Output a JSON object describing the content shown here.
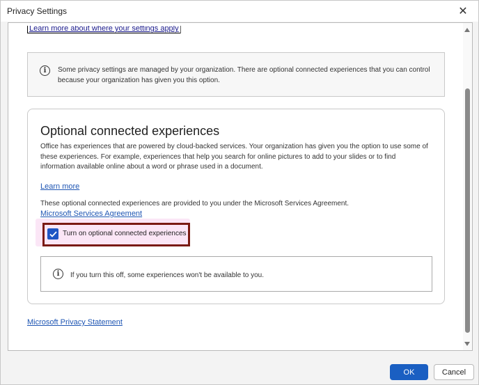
{
  "window": {
    "title": "Privacy Settings",
    "close_glyph": "✕"
  },
  "top_link": "Learn more about where your settings apply",
  "info_notice": {
    "icon": "info-icon",
    "text": "Some privacy settings are managed by your organization. There are optional connected experiences that you can control because your organization has given you this option."
  },
  "card": {
    "heading": "Optional connected experiences",
    "description": "Office has experiences that are powered by cloud-backed services. Your organization has given you the option to use some of these experiences. For example, experiences that help you search for online pictures to add to your slides or to find information available online about a word or phrase used in a document.",
    "learn_more": "Learn more",
    "msa_text": "These optional connected experiences are provided to you under the Microsoft Services Agreement.",
    "msa_link": "Microsoft Services Agreement",
    "checkbox": {
      "label": "Turn on optional connected experiences",
      "checked": true
    },
    "inner_notice": "If you turn this off, some experiences won't be available to you."
  },
  "privacy_link": "Microsoft Privacy Statement",
  "buttons": {
    "ok": "OK",
    "cancel": "Cancel"
  },
  "colors": {
    "accent": "#1a5fc2",
    "highlight_frame": "#7a1a12",
    "highlight_bg": "#fbe6f6"
  }
}
